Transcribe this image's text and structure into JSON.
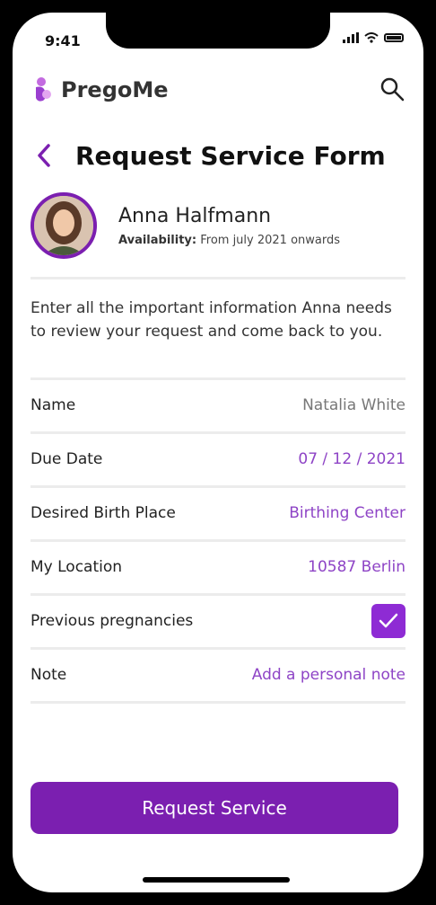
{
  "status_bar": {
    "time": "9:41"
  },
  "app": {
    "name": "PregoMe"
  },
  "page": {
    "title": "Request Service Form"
  },
  "profile": {
    "name": "Anna Halfmann",
    "availability_label": "Availability:",
    "availability_value": "From july 2021 onwards"
  },
  "intro": "Enter all the important information Anna needs to review your request and come back to you.",
  "form": {
    "name": {
      "label": "Name",
      "value": "Natalia White"
    },
    "due_date": {
      "label": "Due Date",
      "value": "07 / 12 / 2021"
    },
    "birth_place": {
      "label": "Desired Birth Place",
      "value": "Birthing Center"
    },
    "location": {
      "label": "My Location",
      "value": "10587 Berlin"
    },
    "previous_pregnancies": {
      "label": "Previous pregnancies",
      "checked": true
    },
    "note": {
      "label": "Note",
      "placeholder": "Add a personal note"
    }
  },
  "cta": {
    "label": "Request Service"
  },
  "colors": {
    "accent": "#7b1fb0",
    "value_text": "#8e44c6"
  },
  "icons": [
    "logo-icon",
    "search-icon",
    "back-icon",
    "checkmark-icon",
    "signal-icon",
    "wifi-icon",
    "battery-icon"
  ]
}
